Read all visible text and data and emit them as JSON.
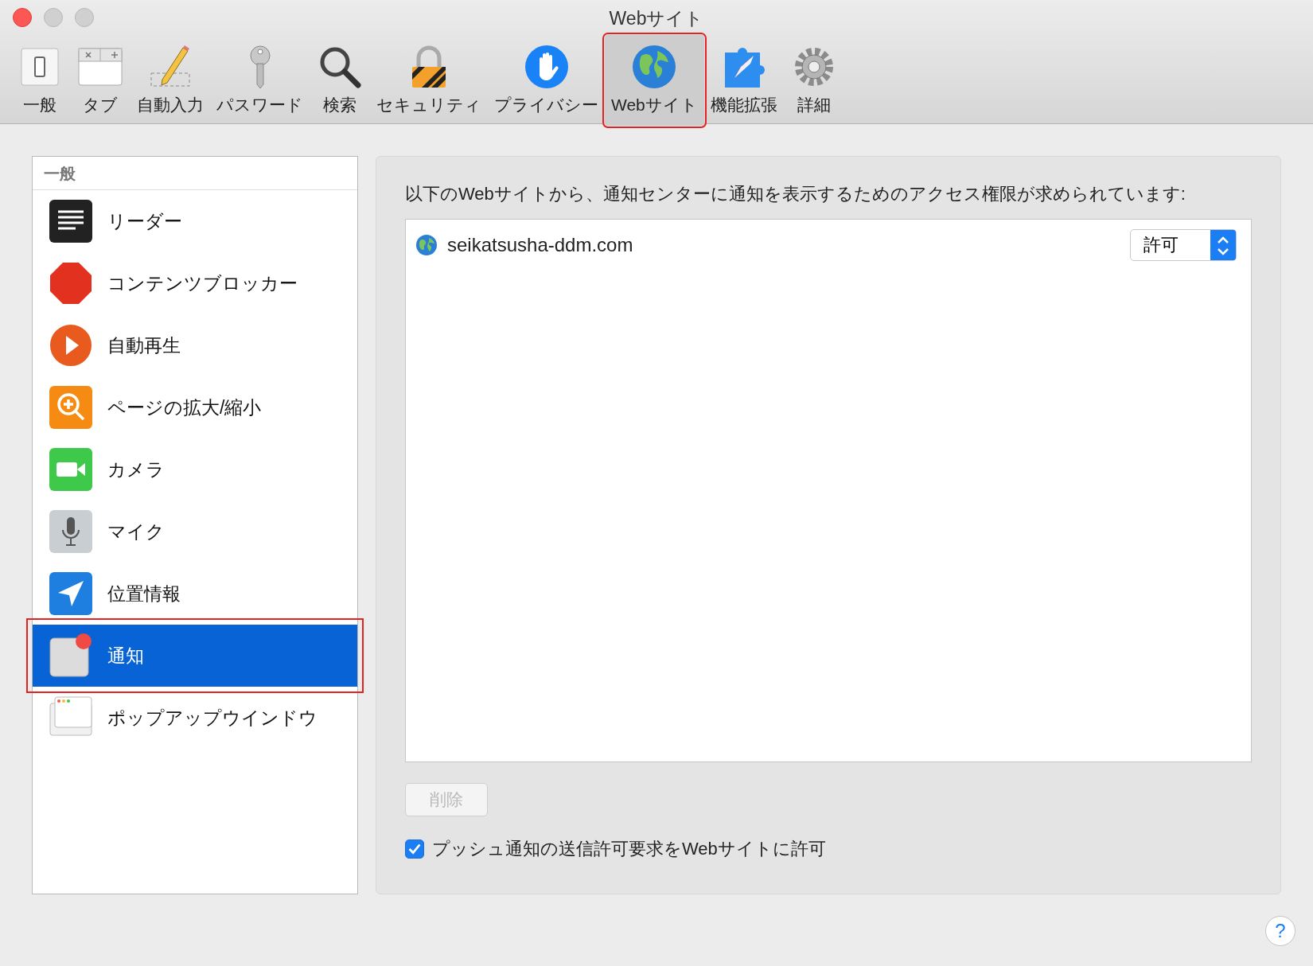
{
  "window": {
    "title": "Webサイト"
  },
  "toolbar": [
    {
      "label": "一般",
      "selected": false,
      "highlighted": false
    },
    {
      "label": "タブ",
      "selected": false,
      "highlighted": false
    },
    {
      "label": "自動入力",
      "selected": false,
      "highlighted": false
    },
    {
      "label": "パスワード",
      "selected": false,
      "highlighted": false
    },
    {
      "label": "検索",
      "selected": false,
      "highlighted": false
    },
    {
      "label": "セキュリティ",
      "selected": false,
      "highlighted": false
    },
    {
      "label": "プライバシー",
      "selected": false,
      "highlighted": false
    },
    {
      "label": "Webサイト",
      "selected": true,
      "highlighted": true
    },
    {
      "label": "機能拡張",
      "selected": false,
      "highlighted": false
    },
    {
      "label": "詳細",
      "selected": false,
      "highlighted": false
    }
  ],
  "sidebar": {
    "header": "一般",
    "items": [
      {
        "label": "リーダー",
        "selected": false,
        "highlighted": false
      },
      {
        "label": "コンテンツブロッカー",
        "selected": false,
        "highlighted": false
      },
      {
        "label": "自動再生",
        "selected": false,
        "highlighted": false
      },
      {
        "label": "ページの拡大/縮小",
        "selected": false,
        "highlighted": false
      },
      {
        "label": "カメラ",
        "selected": false,
        "highlighted": false
      },
      {
        "label": "マイク",
        "selected": false,
        "highlighted": false
      },
      {
        "label": "位置情報",
        "selected": false,
        "highlighted": false
      },
      {
        "label": "通知",
        "selected": true,
        "highlighted": true
      },
      {
        "label": "ポップアップウインドウ",
        "selected": false,
        "highlighted": false
      }
    ]
  },
  "panel": {
    "description": "以下のWebサイトから、通知センターに通知を表示するためのアクセス権限が求められています:",
    "sites": [
      {
        "domain": "seikatsusha-ddm.com",
        "setting": "許可"
      }
    ],
    "remove_button": {
      "label": "削除",
      "disabled": true
    },
    "checkbox": {
      "label": "プッシュ通知の送信許可要求をWebサイトに許可",
      "checked": true
    }
  },
  "help": "?"
}
